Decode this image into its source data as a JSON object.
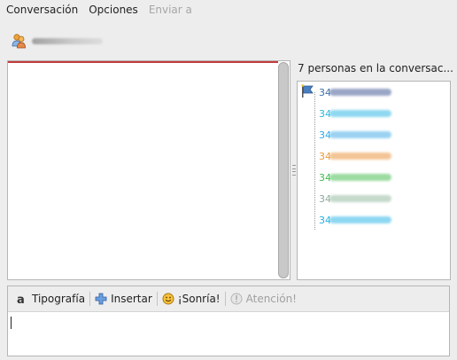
{
  "menu": {
    "items": [
      {
        "label": "Conversación",
        "enabled": true
      },
      {
        "label": "Opciones",
        "enabled": true
      },
      {
        "label": "Enviar a",
        "enabled": false
      }
    ]
  },
  "participants": {
    "title": "7 personas en la conversac...",
    "items": [
      {
        "prefix": "34",
        "color": "#3b6ea8",
        "blur_color": "#9aa6c6",
        "owner": true
      },
      {
        "prefix": "34",
        "color": "#2bb6d8",
        "blur_color": "#8fd8f1",
        "owner": false
      },
      {
        "prefix": "34",
        "color": "#2aa9e8",
        "blur_color": "#9bd2f2",
        "owner": false
      },
      {
        "prefix": "34",
        "color": "#e89a3c",
        "blur_color": "#f3c596",
        "owner": false
      },
      {
        "prefix": "34",
        "color": "#3dbb4d",
        "blur_color": "#9cdca2",
        "owner": false
      },
      {
        "prefix": "34",
        "color": "#8ea89a",
        "blur_color": "#c6dacc",
        "owner": false
      },
      {
        "prefix": "34",
        "color": "#23aee0",
        "blur_color": "#8ed7f2",
        "owner": false
      }
    ]
  },
  "toolbar": {
    "font_label": "Tipografía",
    "insert_label": "Insertar",
    "smile_label": "¡Sonría!",
    "attention_label": "Atención!"
  },
  "colors": {
    "chat_top_accent": "#c43b3b"
  }
}
